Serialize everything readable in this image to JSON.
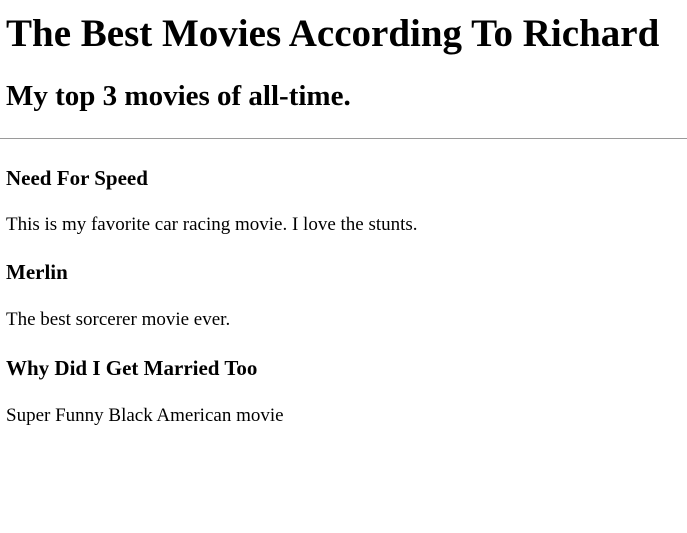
{
  "page": {
    "title": "The Best Movies According To Richard",
    "subtitle": "My top 3 movies of all-time."
  },
  "movies": [
    {
      "title": "Need For Speed",
      "description": "This is my favorite car racing movie. I love the stunts."
    },
    {
      "title": "Merlin",
      "description": "The best sorcerer movie ever."
    },
    {
      "title": "Why Did I Get Married Too",
      "description": "Super Funny Black American movie"
    }
  ]
}
